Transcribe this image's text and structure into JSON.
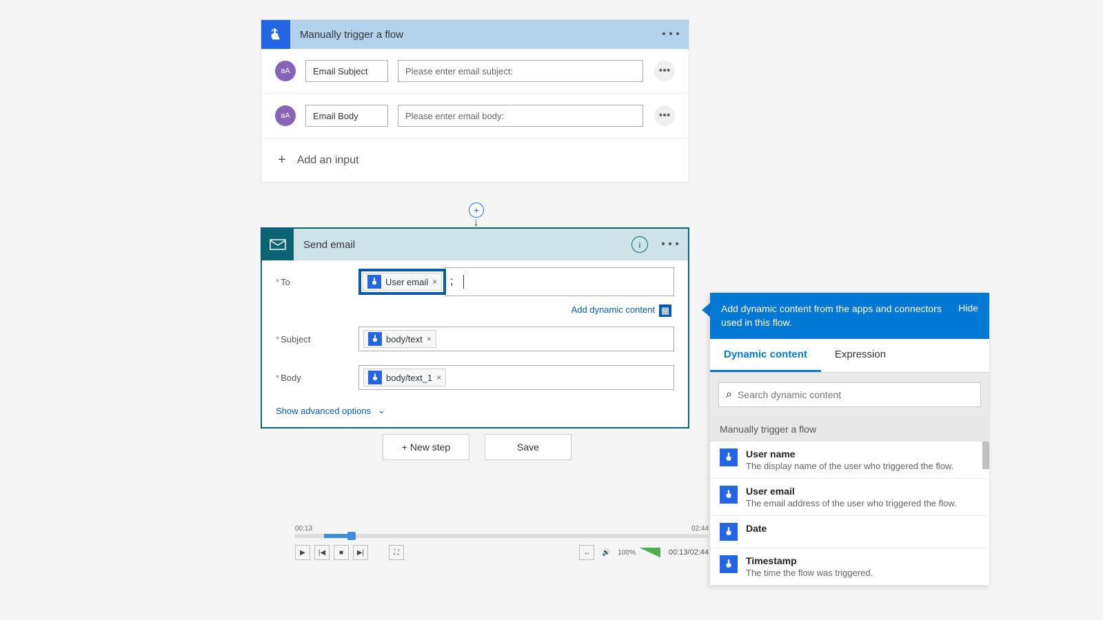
{
  "trigger": {
    "title": "Manually trigger a flow",
    "inputs": [
      {
        "icon": "aA",
        "name": "Email Subject",
        "prompt": "Please enter email subject:"
      },
      {
        "icon": "aA",
        "name": "Email Body",
        "prompt": "Please enter email body:"
      }
    ],
    "add_input_label": "Add an input"
  },
  "action": {
    "title": "Send email",
    "fields": {
      "to": {
        "label": "To",
        "token": "User email"
      },
      "subject": {
        "label": "Subject",
        "token": "body/text"
      },
      "body": {
        "label": "Body",
        "token": "body/text_1"
      }
    },
    "add_dynamic_label": "Add dynamic content",
    "advanced_label": "Show advanced options"
  },
  "buttons": {
    "new_step": "+ New step",
    "save": "Save"
  },
  "dynamic_panel": {
    "header": "Add dynamic content from the apps and connectors used in this flow.",
    "hide": "Hide",
    "tab_dynamic": "Dynamic content",
    "tab_expression": "Expression",
    "search_placeholder": "Search dynamic content",
    "group_title": "Manually trigger a flow",
    "items": [
      {
        "title": "User name",
        "desc": "The display name of the user who triggered the flow."
      },
      {
        "title": "User email",
        "desc": "The email address of the user who triggered the flow."
      },
      {
        "title": "Date",
        "desc": ""
      },
      {
        "title": "Timestamp",
        "desc": "The time the flow was triggered."
      }
    ]
  },
  "player": {
    "time_left": "00:13",
    "time_right": "02:44",
    "time_combo": "00:13/02:44",
    "zoom": "100%"
  }
}
